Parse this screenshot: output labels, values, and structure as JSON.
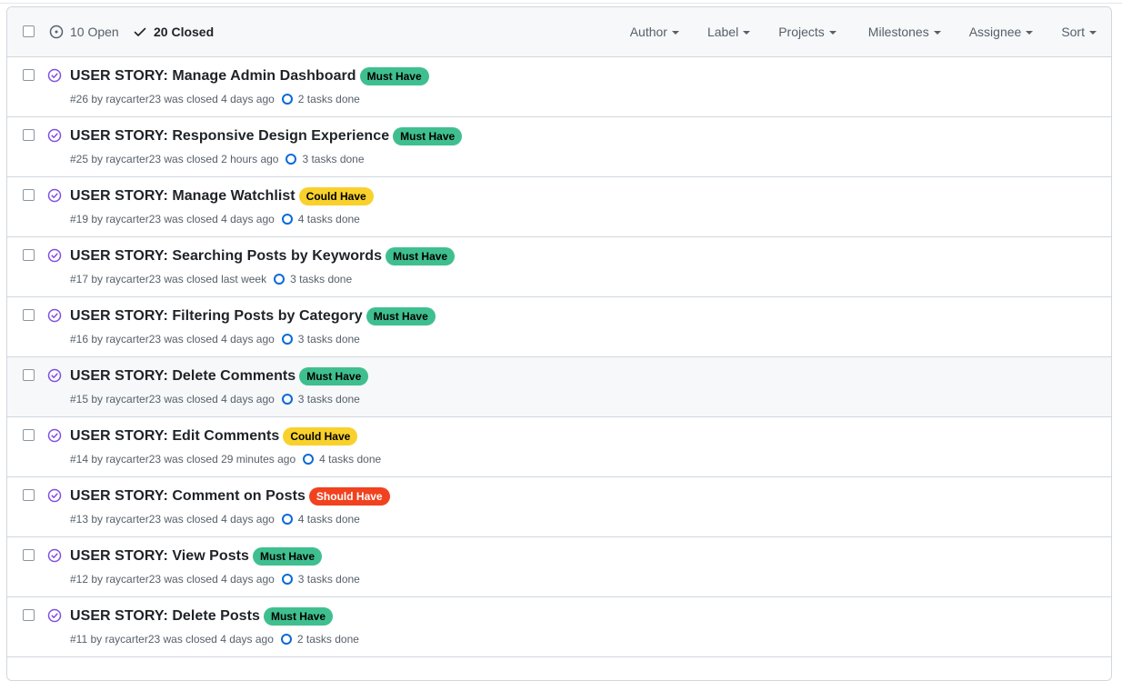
{
  "header": {
    "open_label": "10 Open",
    "closed_label": "20 Closed",
    "filters": [
      "Author",
      "Label",
      "Projects",
      "Milestones",
      "Assignee",
      "Sort"
    ]
  },
  "issues": [
    {
      "title": "USER STORY: Manage Admin Dashboard",
      "label": "Must Have",
      "meta": "#26 by raycarter23 was closed 4 days ago",
      "tasks": "2 tasks done"
    },
    {
      "title": "USER STORY: Responsive Design Experience",
      "label": "Must Have",
      "meta": "#25 by raycarter23 was closed 2 hours ago",
      "tasks": "3 tasks done"
    },
    {
      "title": "USER STORY: Manage Watchlist",
      "label": "Could Have",
      "meta": "#19 by raycarter23 was closed 4 days ago",
      "tasks": "4 tasks done"
    },
    {
      "title": "USER STORY: Searching Posts by Keywords",
      "label": "Must Have",
      "meta": "#17 by raycarter23 was closed last week",
      "tasks": "3 tasks done"
    },
    {
      "title": "USER STORY: Filtering Posts by Category",
      "label": "Must Have",
      "meta": "#16 by raycarter23 was closed 4 days ago",
      "tasks": "3 tasks done"
    },
    {
      "title": "USER STORY: Delete Comments",
      "label": "Must Have",
      "meta": "#15 by raycarter23 was closed 4 days ago",
      "tasks": "3 tasks done"
    },
    {
      "title": "USER STORY: Edit Comments",
      "label": "Could Have",
      "meta": "#14 by raycarter23 was closed 29 minutes ago",
      "tasks": "4 tasks done"
    },
    {
      "title": "USER STORY: Comment on Posts",
      "label": "Should Have",
      "meta": "#13 by raycarter23 was closed 4 days ago",
      "tasks": "4 tasks done"
    },
    {
      "title": "USER STORY: View Posts",
      "label": "Must Have",
      "meta": "#12 by raycarter23 was closed 4 days ago",
      "tasks": "3 tasks done"
    },
    {
      "title": "USER STORY: Delete Posts",
      "label": "Must Have",
      "meta": "#11 by raycarter23 was closed 4 days ago",
      "tasks": "2 tasks done"
    }
  ],
  "colors": {
    "Must Have": {
      "bg": "#3fbf8f",
      "fg": "#000000"
    },
    "Could Have": {
      "bg": "#f9d12c",
      "fg": "#000000"
    },
    "Should Have": {
      "bg": "#f1421f",
      "fg": "#ffffff"
    },
    "closed_icon": "#8250df",
    "task_ring": "#0969da"
  },
  "icons": {
    "open": "issue-opened-icon",
    "closed_header": "check-icon",
    "row": "issue-closed-icon"
  },
  "hovered_row": 5
}
